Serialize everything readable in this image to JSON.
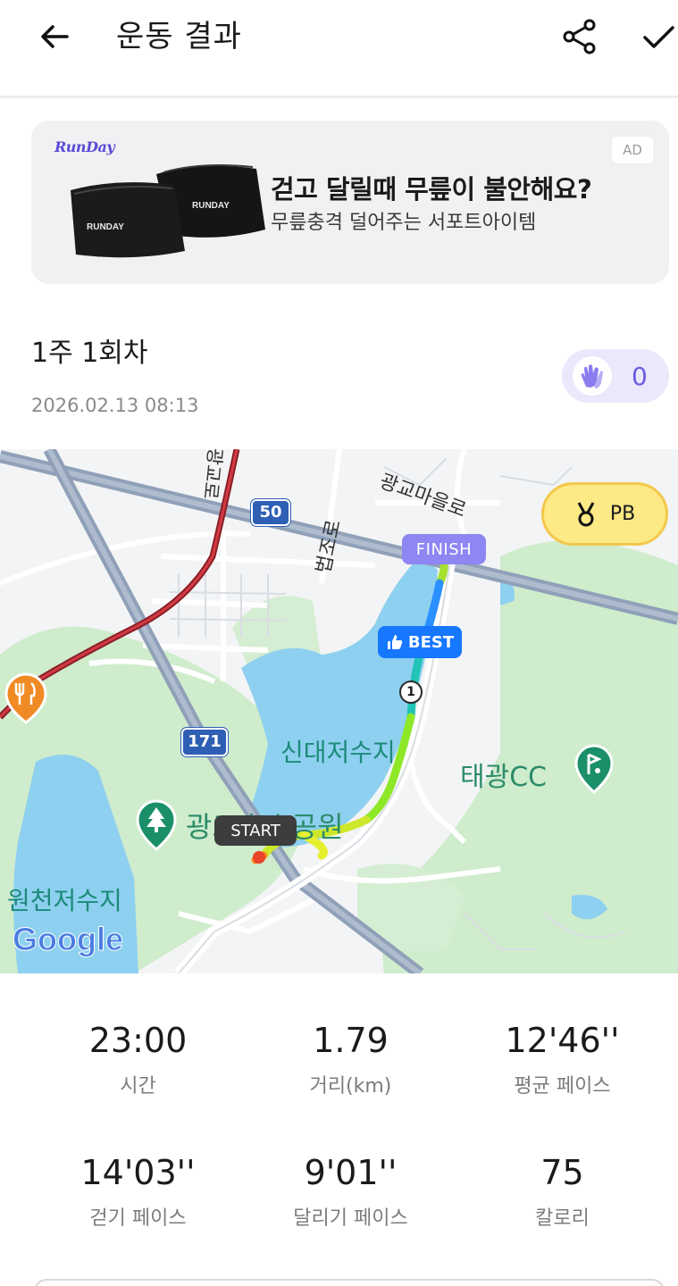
{
  "header": {
    "title": "운동 결과"
  },
  "ad": {
    "brand": "RunDay",
    "badge": "AD",
    "headline": "걷고 달릴때 무릎이 불안해요?",
    "subtext": "무릎충격 덜어주는 서포트아이템",
    "product_text": "RUNDAY"
  },
  "session": {
    "title": "1주 1회차",
    "date": "2026.02.13 08:13",
    "clap_count": "0"
  },
  "map": {
    "pb_label": "PB",
    "finish_label": "FINISH",
    "best_label": "BEST",
    "start_label": "START",
    "km_marker": "1",
    "labels": {
      "gwanggyo_ro_upper": "광교로",
      "gwanggyo_maeul_ro": "광교마을로",
      "route_50": "50",
      "beopjo_ro": "법조로",
      "route_171": "171",
      "lake_name": "신대저수지",
      "golf_club": "태광CC",
      "park_name": "광교호수공원",
      "wonchon_lake": "원천저수지",
      "google": "Google"
    },
    "colors": {
      "park": "#c9e9c9",
      "water": "#8fd0ee",
      "highway": "#8fa0b7",
      "red_line": "#b3242d"
    }
  },
  "stats": [
    {
      "value": "23:00",
      "label": "시간"
    },
    {
      "value": "1.79",
      "label": "거리(km)"
    },
    {
      "value": "12'46''",
      "label": "평균 페이스"
    },
    {
      "value": "14'03''",
      "label": "걷기 페이스"
    },
    {
      "value": "9'01''",
      "label": "달리기 페이스"
    },
    {
      "value": "75",
      "label": "칼로리"
    }
  ]
}
